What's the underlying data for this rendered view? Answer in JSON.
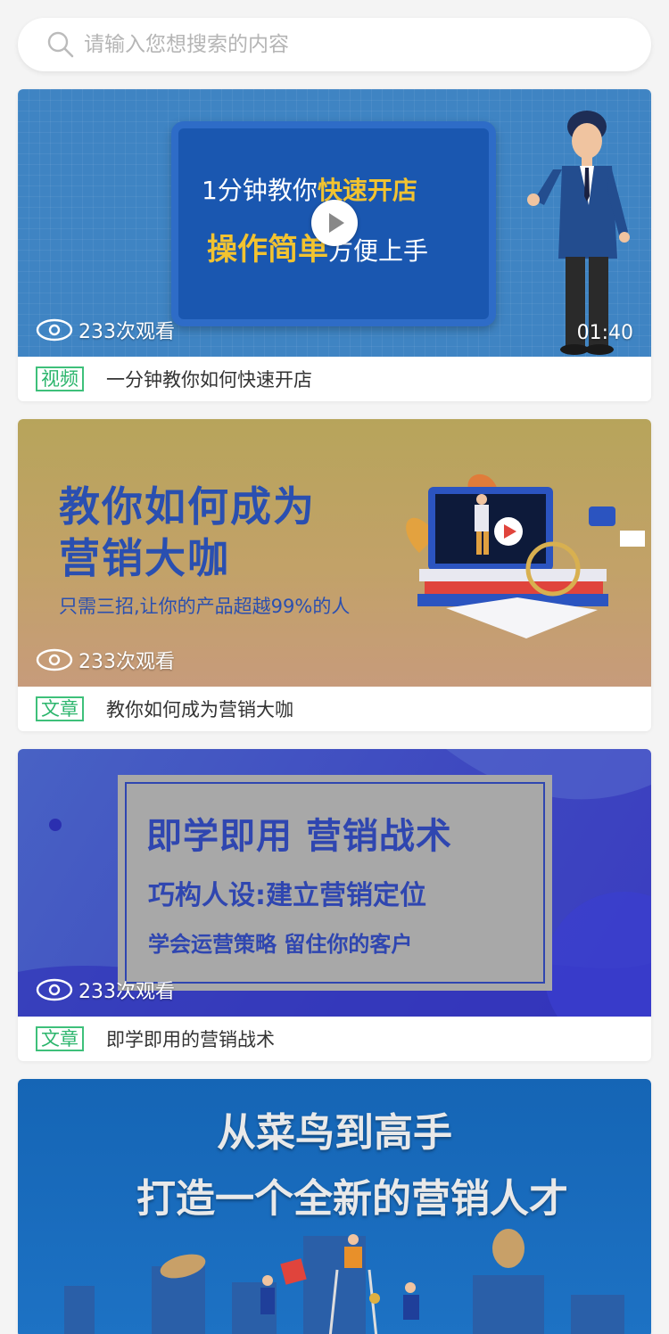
{
  "search": {
    "placeholder": "请输入您想搜索的内容"
  },
  "cards": [
    {
      "tag": "视频",
      "title": "一分钟教你如何快速开店",
      "views": "233次观看",
      "duration": "01:40",
      "banner": {
        "line1_plain": "1分钟教你",
        "line1_highlight": "快速开店",
        "line2_highlight": "操作简单",
        "line2_plain": "方便上手"
      }
    },
    {
      "tag": "文章",
      "title": "教你如何成为营销大咖",
      "views": "233次观看",
      "banner": {
        "headline1": "教你如何成为",
        "headline2": "营销大咖",
        "subline": "只需三招,让你的产品超越99%的人"
      }
    },
    {
      "tag": "文章",
      "title": "即学即用的营销战术",
      "views": "233次观看",
      "banner": {
        "line1": "即学即用 营销战术",
        "line2": "巧构人设:建立营销定位",
        "line3": "学会运营策略 留住你的客户"
      }
    },
    {
      "banner": {
        "line1": "从菜鸟到高手",
        "line2": "打造一个全新的营销人才"
      }
    }
  ],
  "colors": {
    "tag_green": "#3ec07a",
    "page_bg": "#f4f4f4",
    "banner_text_blue": "#2a4fb0"
  }
}
